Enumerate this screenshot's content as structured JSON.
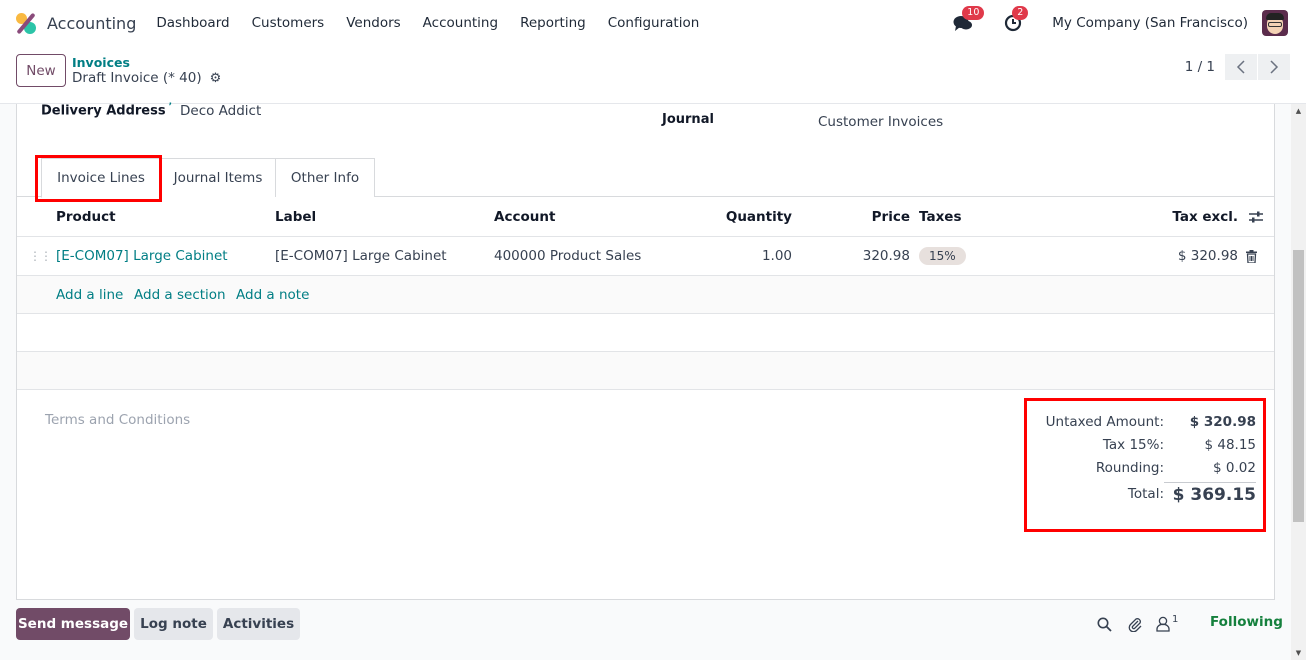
{
  "navbar": {
    "app_name": "Accounting",
    "menu": [
      "Dashboard",
      "Customers",
      "Vendors",
      "Accounting",
      "Reporting",
      "Configuration"
    ],
    "messages_count": "10",
    "activities_count": "2",
    "company": "My Company (San Francisco)"
  },
  "control": {
    "new_label": "New",
    "breadcrumb_parent": "Invoices",
    "breadcrumb_current": "Draft Invoice (* 40)",
    "pager": "1 / 1"
  },
  "form": {
    "delivery_address_label": "Delivery Address",
    "delivery_address_tooltip": "?",
    "delivery_address_value": "Deco Addict",
    "journal_label": "Journal",
    "journal_value": "Customer Invoices"
  },
  "tabs": [
    {
      "label": "Invoice Lines",
      "active": true
    },
    {
      "label": "Journal Items",
      "active": false
    },
    {
      "label": "Other Info",
      "active": false
    }
  ],
  "lines": {
    "headers": {
      "product": "Product",
      "label": "Label",
      "account": "Account",
      "quantity": "Quantity",
      "price": "Price",
      "taxes": "Taxes",
      "subtotal": "Tax excl."
    },
    "rows": [
      {
        "product": "[E-COM07] Large Cabinet",
        "label": "[E-COM07] Large Cabinet",
        "account": "400000 Product Sales",
        "quantity": "1.00",
        "price": "320.98",
        "taxes": "15%",
        "subtotal": "$ 320.98"
      }
    ],
    "add_line": "Add a line",
    "add_section": "Add a section",
    "add_note": "Add a note"
  },
  "terms_placeholder": "Terms and Conditions",
  "totals": {
    "untaxed_label": "Untaxed Amount:",
    "untaxed_value": "$ 320.98",
    "tax_label": "Tax 15%:",
    "tax_value": "$ 48.15",
    "rounding_label": "Rounding:",
    "rounding_value": "$ 0.02",
    "total_label": "Total:",
    "total_value": "$ 369.15"
  },
  "chatter": {
    "send_message": "Send message",
    "log_note": "Log note",
    "activities": "Activities",
    "followers_count": "1",
    "following": "Following"
  },
  "colors": {
    "brand": "#714b67",
    "link": "#017e84",
    "highlight": "#ff0000",
    "following": "#15803d",
    "badge": "#e0394a"
  }
}
